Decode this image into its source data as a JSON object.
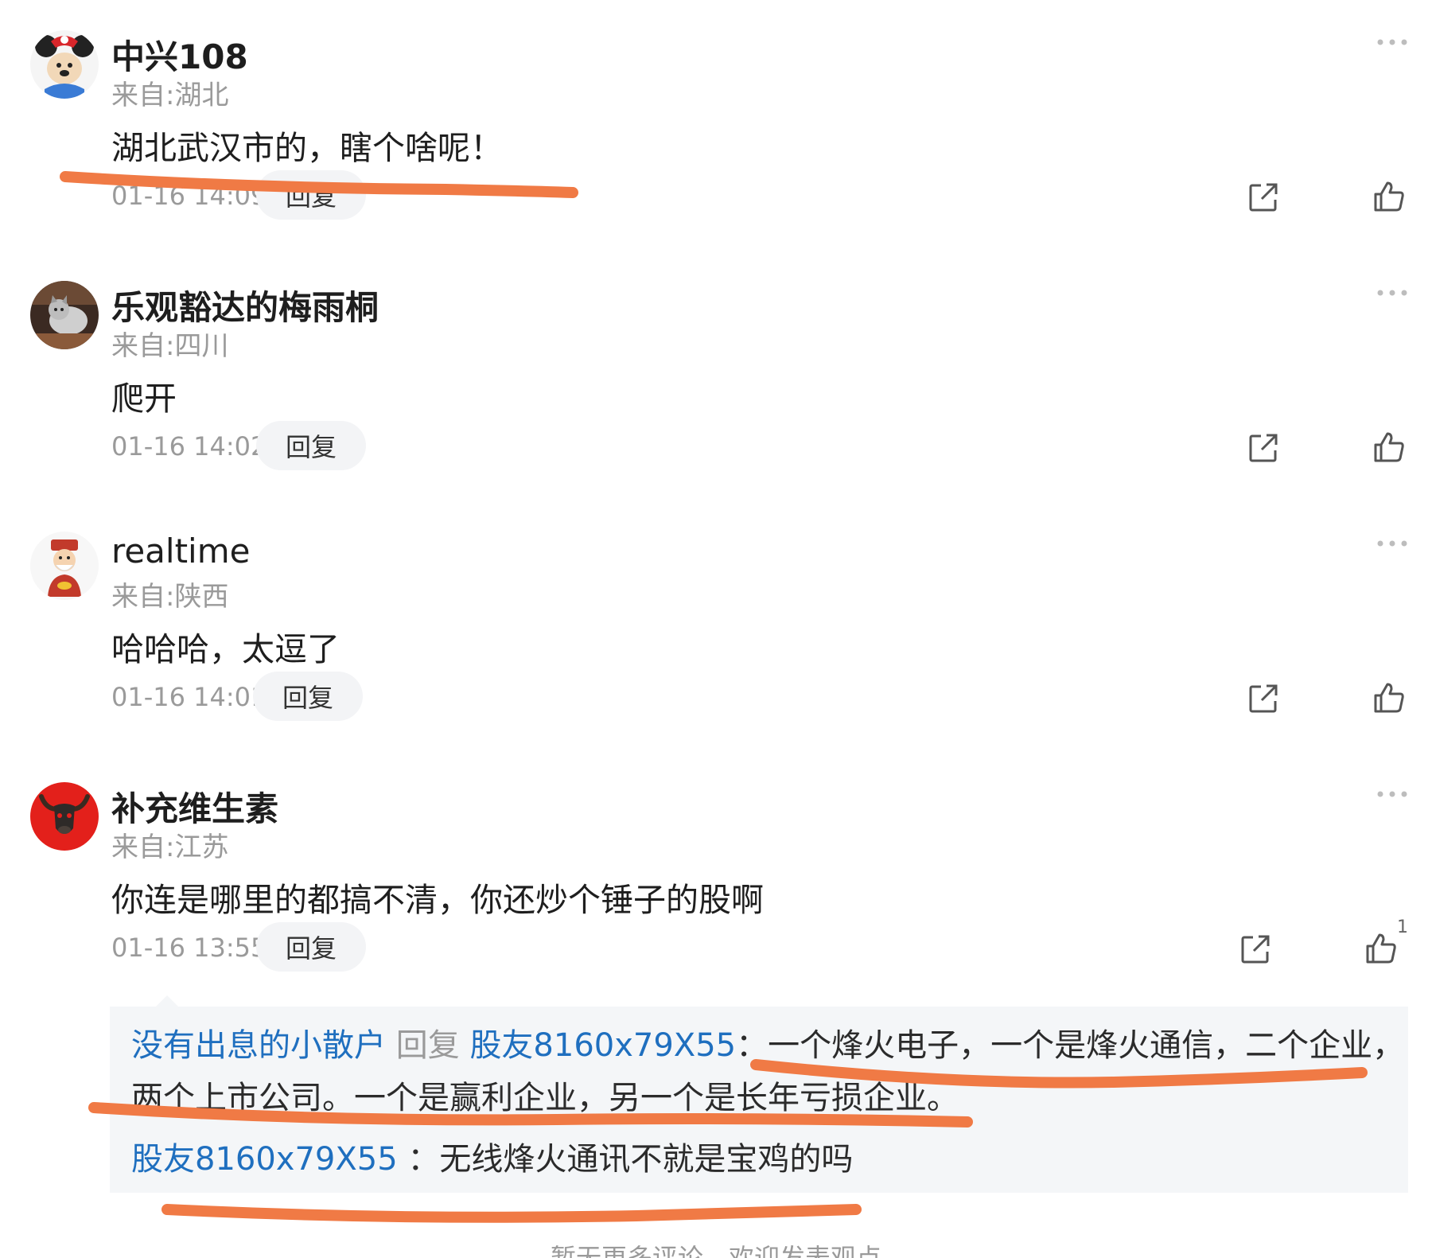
{
  "comments": [
    {
      "username": "中兴108",
      "location": "来自:湖北",
      "content": "湖北武汉市的，瞎个啥呢！",
      "time": "01-16 14:09",
      "reply_label": "回复",
      "likes": ""
    },
    {
      "username": "乐观豁达的梅雨桐",
      "location": "来自:四川",
      "content": "爬开",
      "time": "01-16 14:02",
      "reply_label": "回复",
      "likes": ""
    },
    {
      "username": "realtime",
      "location": "来自:陕西",
      "content": "哈哈哈，太逗了",
      "time": "01-16 14:01",
      "reply_label": "回复",
      "likes": ""
    },
    {
      "username": "补充维生素",
      "location": "来自:江苏",
      "content": "你连是哪里的都搞不清，你还炒个锤子的股啊",
      "time": "01-16 13:55",
      "reply_label": "回复",
      "likes": "1"
    }
  ],
  "sub_replies": [
    {
      "author": "没有出息的小散户",
      "reply_word": "回复",
      "target": "股友8160x79X55",
      "separator": "：",
      "text_line1": "一个烽火电子，一个是烽火通信，二个企业，",
      "text_line2": "两个上市公司。一个是赢利企业，另一个是长年亏损企业。"
    },
    {
      "author": "股友8160x79X55",
      "separator": " ：",
      "text": "无线烽火通讯不就是宝鸡的吗"
    }
  ],
  "footer_hint": "暂无更多评论，欢迎发表观点",
  "icons": {
    "more": "more-dots-icon",
    "share": "share-icon",
    "like": "thumbs-up-icon"
  },
  "colors": {
    "link_blue": "#1f6fbf",
    "annotation_orange": "#f07a45",
    "meta_grey": "#9a9a9a"
  }
}
